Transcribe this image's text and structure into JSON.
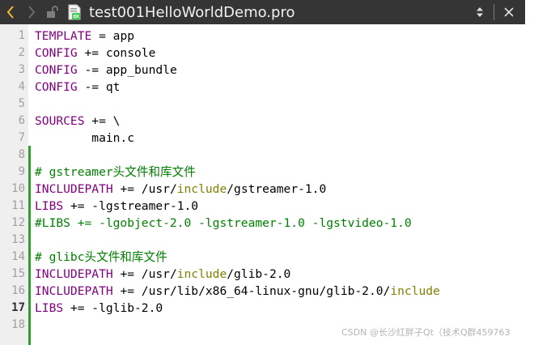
{
  "toolbar": {
    "back_icon": "chevron-left-icon",
    "forward_icon": "chevron-right-icon",
    "lock_icon": "unlocked-padlock-icon",
    "file_icon": "qmake-project-file-icon",
    "file_name": "test001HelloWorldDemo.pro",
    "combo_icon": "up-down-arrows-icon",
    "close_icon": "close-icon"
  },
  "editor": {
    "current_line": 17,
    "lines": [
      {
        "n": "1",
        "parts": [
          {
            "t": "TEMPLATE",
            "c": "var"
          },
          {
            "t": " = app",
            "c": ""
          }
        ]
      },
      {
        "n": "2",
        "parts": [
          {
            "t": "CONFIG",
            "c": "var"
          },
          {
            "t": " += console",
            "c": ""
          }
        ]
      },
      {
        "n": "3",
        "parts": [
          {
            "t": "CONFIG",
            "c": "var"
          },
          {
            "t": " -= app_bundle",
            "c": ""
          }
        ]
      },
      {
        "n": "4",
        "parts": [
          {
            "t": "CONFIG",
            "c": "var"
          },
          {
            "t": " -= qt",
            "c": ""
          }
        ]
      },
      {
        "n": "5",
        "parts": []
      },
      {
        "n": "6",
        "parts": [
          {
            "t": "SOURCES",
            "c": "var"
          },
          {
            "t": " += \\",
            "c": ""
          }
        ]
      },
      {
        "n": "7",
        "parts": [
          {
            "t": "        main.c",
            "c": ""
          }
        ]
      },
      {
        "n": "8",
        "parts": []
      },
      {
        "n": "9",
        "parts": [
          {
            "t": "# gstreamer头文件和库文件",
            "c": "cmt"
          }
        ]
      },
      {
        "n": "10",
        "parts": [
          {
            "t": "INCLUDEPATH",
            "c": "var"
          },
          {
            "t": " += /usr/",
            "c": ""
          },
          {
            "t": "include",
            "c": "kw"
          },
          {
            "t": "/gstreamer-1.0",
            "c": ""
          }
        ]
      },
      {
        "n": "11",
        "parts": [
          {
            "t": "LIBS",
            "c": "var"
          },
          {
            "t": " += -lgstreamer-1.0",
            "c": ""
          }
        ]
      },
      {
        "n": "12",
        "parts": [
          {
            "t": "#LIBS += -lgobject-2.0 -lgstreamer-1.0 -lgstvideo-1.0",
            "c": "cmt"
          }
        ]
      },
      {
        "n": "13",
        "parts": []
      },
      {
        "n": "14",
        "parts": [
          {
            "t": "# glibc头文件和库文件",
            "c": "cmt"
          }
        ]
      },
      {
        "n": "15",
        "parts": [
          {
            "t": "INCLUDEPATH",
            "c": "var"
          },
          {
            "t": " += /usr/",
            "c": ""
          },
          {
            "t": "include",
            "c": "kw"
          },
          {
            "t": "/glib-2.0",
            "c": ""
          }
        ]
      },
      {
        "n": "16",
        "parts": [
          {
            "t": "INCLUDEPATH",
            "c": "var"
          },
          {
            "t": " += /usr/lib/x86_64-linux-gnu/glib-2.0/",
            "c": ""
          },
          {
            "t": "include",
            "c": "kw"
          }
        ]
      },
      {
        "n": "17",
        "parts": [
          {
            "t": "LIBS",
            "c": "var"
          },
          {
            "t": " += -lglib-2.0",
            "c": ""
          }
        ]
      },
      {
        "n": "18",
        "parts": []
      }
    ]
  },
  "colors": {
    "variable": "#800080",
    "comment": "#008000",
    "keyword": "#808000",
    "change_marker": "#2f9e2f",
    "toolbar_bg": "#353535"
  },
  "watermark": "CSDN @长沙红胖子Qt（技术Q群459763"
}
